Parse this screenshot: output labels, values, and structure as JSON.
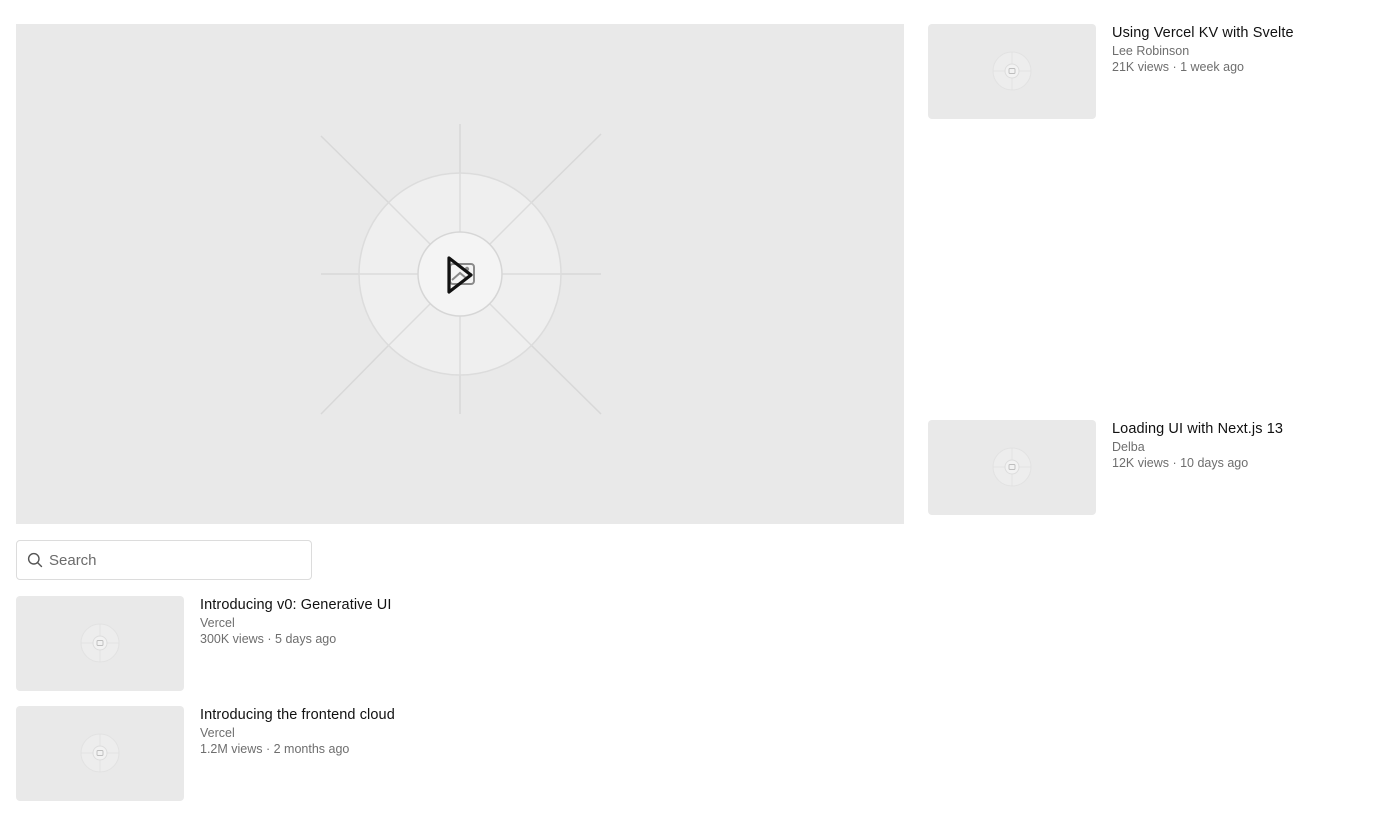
{
  "player": {
    "play_icon": "play-icon",
    "placeholder_icon": "image-icon"
  },
  "search": {
    "placeholder": "Search",
    "value": "",
    "icon": "search-icon"
  },
  "sidebar_videos": [
    {
      "title": "Using Vercel KV with Svelte",
      "author": "Lee Robinson",
      "meta": "21K views · 1 week ago"
    },
    {
      "title": "Loading UI with Next.js 13",
      "author": "Delba",
      "meta": "12K views · 10 days ago"
    }
  ],
  "list_videos": [
    {
      "title": "Introducing v0: Generative UI",
      "author": "Vercel",
      "meta": "300K views · 5 days ago"
    },
    {
      "title": "Introducing the frontend cloud",
      "author": "Vercel",
      "meta": "1.2M views · 2 months ago"
    }
  ]
}
